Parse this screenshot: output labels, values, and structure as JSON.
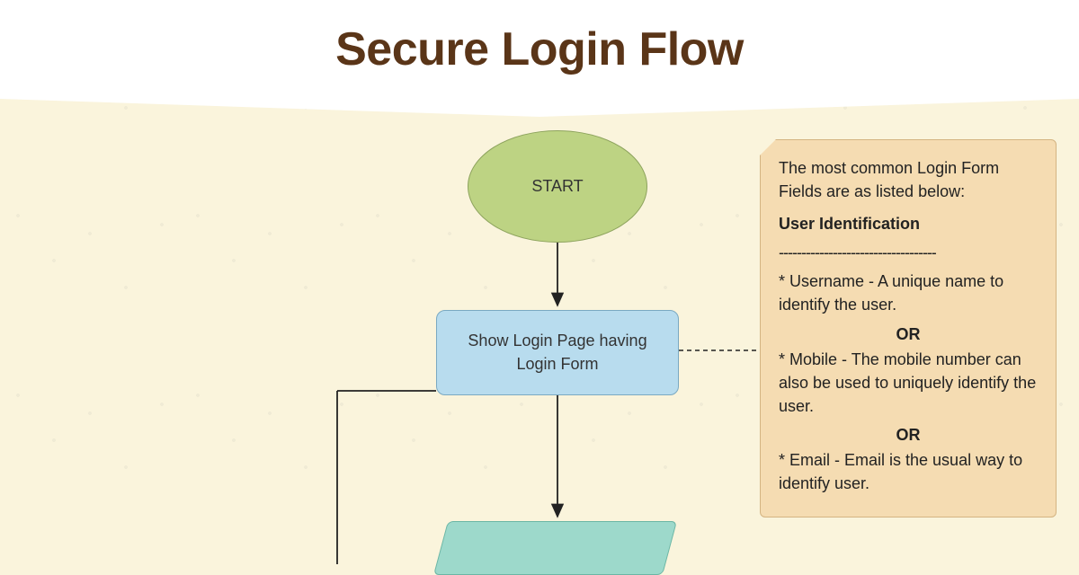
{
  "title": "Secure Login Flow",
  "nodes": {
    "start": "START",
    "show_login": "Show Login Page having Login Form"
  },
  "note": {
    "intro": "The most common Login Form Fields are as listed below:",
    "section_heading": "User Identification",
    "divider": "-----------------------------------",
    "item_username": "* Username - A unique name to identify the user.",
    "or": "OR",
    "item_mobile": "* Mobile - The mobile number can also be used to uniquely identify the user.",
    "item_email": "* Email - Email is the usual way to identify user."
  }
}
